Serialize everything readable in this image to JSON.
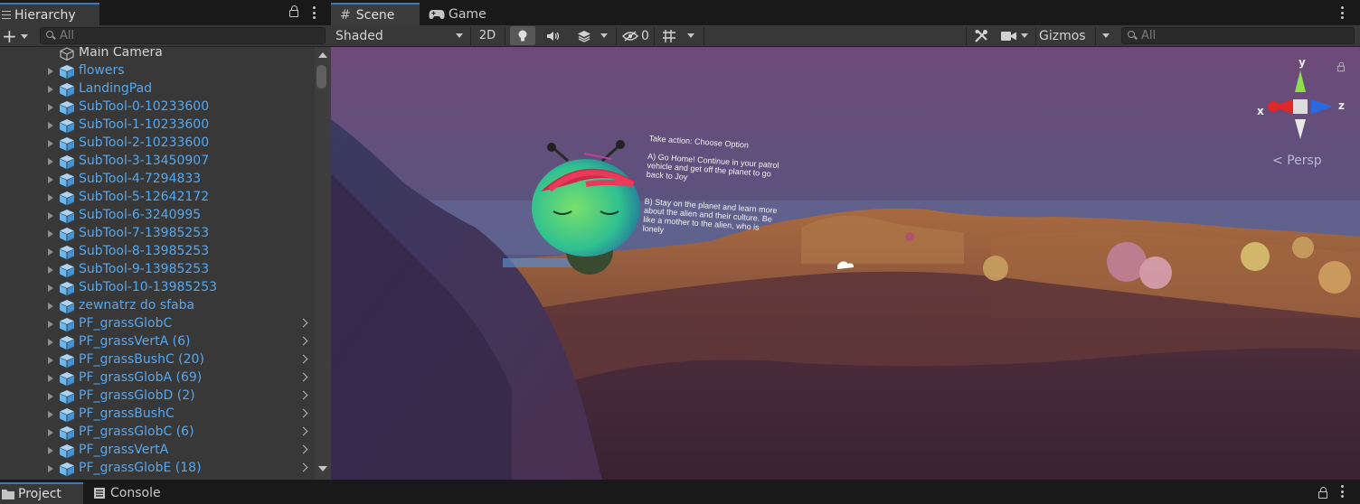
{
  "hierarchy": {
    "tab_label": "Hierarchy",
    "search_placeholder": "All",
    "items": [
      {
        "label": "Main Camera",
        "type": "camera",
        "expandable": false,
        "children": false
      },
      {
        "label": "flowers",
        "type": "prefab",
        "expandable": true,
        "children": false
      },
      {
        "label": "LandingPad",
        "type": "prefab",
        "expandable": true,
        "children": false
      },
      {
        "label": "SubTool-0-10233600",
        "type": "prefab",
        "expandable": true,
        "children": false
      },
      {
        "label": "SubTool-1-10233600",
        "type": "prefab",
        "expandable": true,
        "children": false
      },
      {
        "label": "SubTool-2-10233600",
        "type": "prefab",
        "expandable": true,
        "children": false
      },
      {
        "label": "SubTool-3-13450907",
        "type": "prefab",
        "expandable": true,
        "children": false
      },
      {
        "label": "SubTool-4-7294833",
        "type": "prefab",
        "expandable": true,
        "children": false
      },
      {
        "label": "SubTool-5-12642172",
        "type": "prefab",
        "expandable": true,
        "children": false
      },
      {
        "label": "SubTool-6-3240995",
        "type": "prefab",
        "expandable": true,
        "children": false
      },
      {
        "label": "SubTool-7-13985253",
        "type": "prefab",
        "expandable": true,
        "children": false
      },
      {
        "label": "SubTool-8-13985253",
        "type": "prefab",
        "expandable": true,
        "children": false
      },
      {
        "label": "SubTool-9-13985253",
        "type": "prefab",
        "expandable": true,
        "children": false
      },
      {
        "label": "SubTool-10-13985253",
        "type": "prefab",
        "expandable": true,
        "children": false
      },
      {
        "label": "zewnatrz do sfaba",
        "type": "prefab",
        "expandable": true,
        "children": false
      },
      {
        "label": "PF_grassGlobC",
        "type": "prefab",
        "expandable": true,
        "children": true
      },
      {
        "label": "PF_grassVertA (6)",
        "type": "prefab",
        "expandable": true,
        "children": true
      },
      {
        "label": "PF_grassBushC (20)",
        "type": "prefab",
        "expandable": true,
        "children": true
      },
      {
        "label": "PF_grassGlobA (69)",
        "type": "prefab",
        "expandable": true,
        "children": true
      },
      {
        "label": "PF_grassGlobD (2)",
        "type": "prefab",
        "expandable": true,
        "children": true
      },
      {
        "label": "PF_grassBushC",
        "type": "prefab",
        "expandable": true,
        "children": true
      },
      {
        "label": "PF_grassGlobC (6)",
        "type": "prefab",
        "expandable": true,
        "children": true
      },
      {
        "label": "PF_grassVertA",
        "type": "prefab",
        "expandable": true,
        "children": true
      },
      {
        "label": "PF_grassGlobE (18)",
        "type": "prefab",
        "expandable": true,
        "children": true
      }
    ]
  },
  "scene": {
    "tabs": {
      "scene": "Scene",
      "game": "Game"
    },
    "toolbar": {
      "shading_mode": "Shaded",
      "mode_2d": "2D",
      "hidden_count": "0",
      "gizmos": "Gizmos",
      "search_placeholder": "All"
    },
    "gizmo": {
      "x": "x",
      "y": "y",
      "z": "z",
      "projection": "Persp"
    },
    "viewport_text": {
      "title": "Take action:  Choose Option",
      "option_a": [
        "A) Go Home! Continue in your patrol",
        "vehicle and get off the planet to go",
        "back to Joy"
      ],
      "option_b": [
        "B) Stay on the planet and learn more",
        "about the alien and their culture. Be",
        "like a mother to the alien, who is",
        "lonely"
      ]
    }
  },
  "bottom": {
    "tabs": {
      "project": "Project",
      "console": "Console"
    }
  },
  "colors": {
    "accent_tab": "#3a79bb",
    "prefab_text": "#58a7ec",
    "panel_bg": "#383838"
  }
}
